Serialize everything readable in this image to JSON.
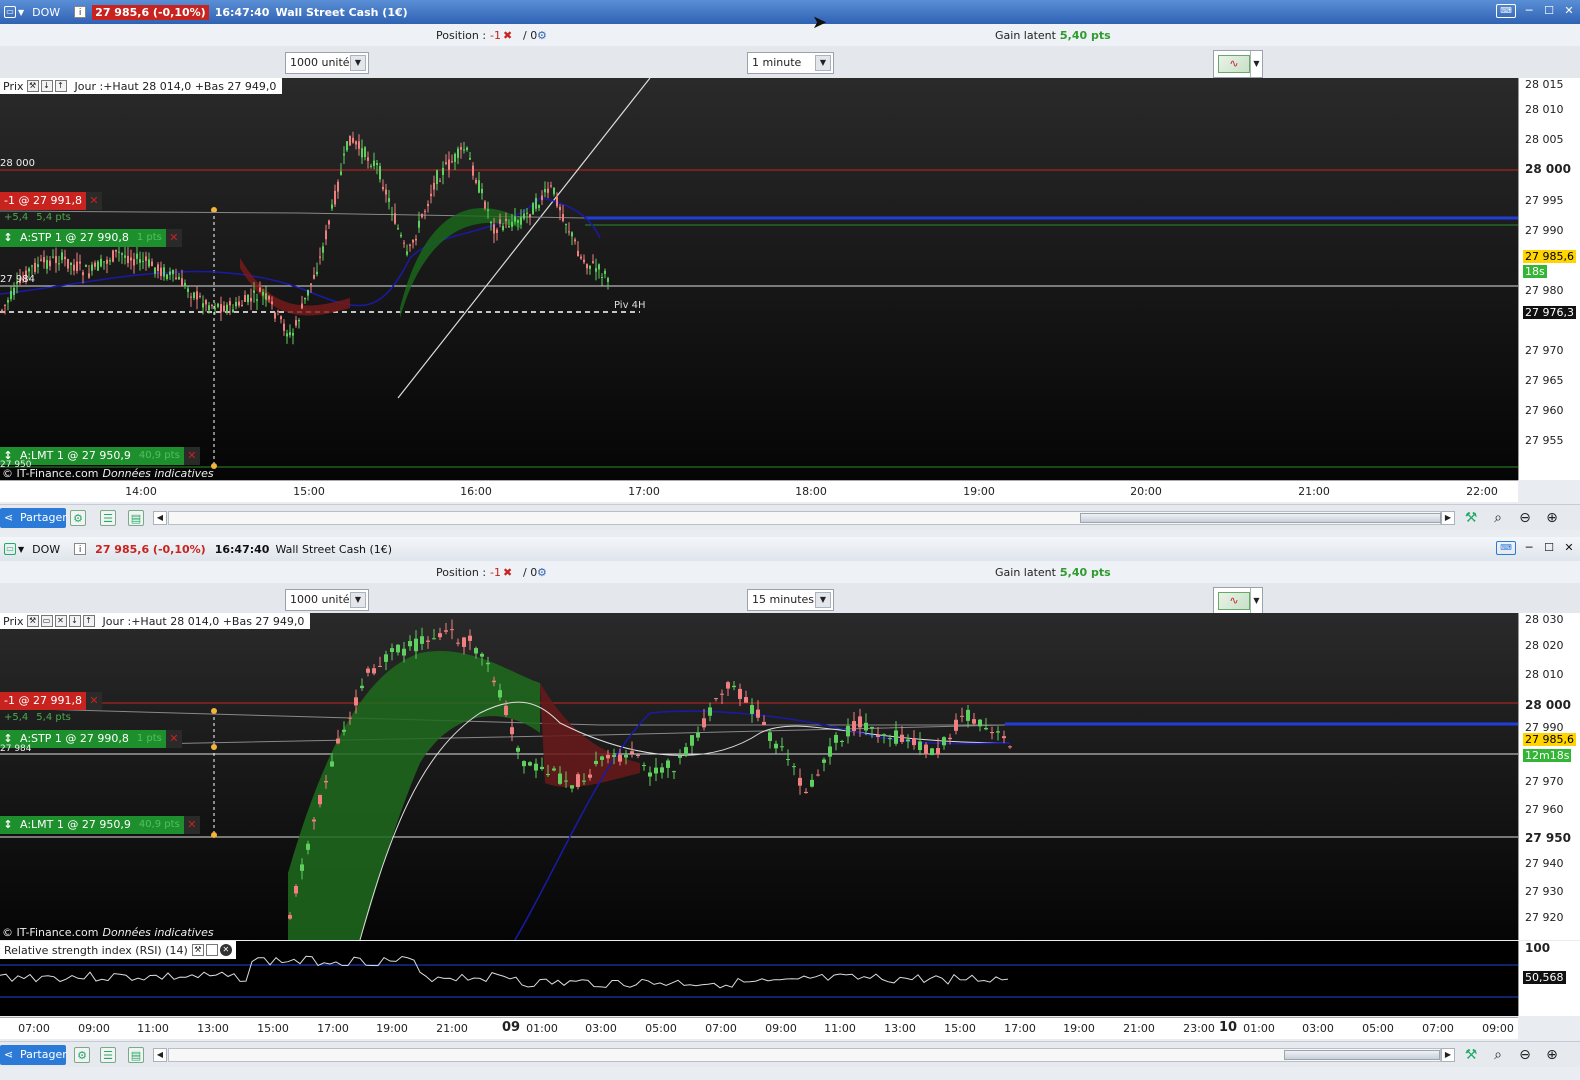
{
  "panels": [
    {
      "title": {
        "symbol": "DOW",
        "price": "27 985,6 (-0,10%)",
        "time": "16:47:40",
        "name": "Wall Street Cash (1€)"
      },
      "position": {
        "label": "Position :",
        "value": "-1",
        "close": "✖",
        "zero": "/ 0",
        "gear": "⚙"
      },
      "gain": {
        "label": "Gain latent :",
        "value": "5,40 pts"
      },
      "units_select": "1000 unités",
      "interval_select": "1 minute",
      "chart_header": {
        "prix": "Prix",
        "text": "Jour :+Haut 28 014,0 +Bas 27 949,0"
      },
      "price_axis": [
        {
          "label": "28 015",
          "style": ""
        },
        {
          "label": "28 010",
          "style": ""
        },
        {
          "label": "28 005",
          "style": ""
        },
        {
          "label": "28 000",
          "style": "bold"
        },
        {
          "label": "27 995",
          "style": ""
        },
        {
          "label": "27 990",
          "style": ""
        },
        {
          "label": "27 985,6",
          "style": "boxy"
        },
        {
          "label": "18s",
          "style": "boxg"
        },
        {
          "label": "27 980",
          "style": ""
        },
        {
          "label": "27 976,3",
          "style": "box"
        },
        {
          "label": "27 970",
          "style": ""
        },
        {
          "label": "27 965",
          "style": ""
        },
        {
          "label": "27 960",
          "style": ""
        },
        {
          "label": "27 955",
          "style": ""
        }
      ],
      "level_label": "28 000",
      "side_label": "27 984",
      "bottom_side_label": "27 950",
      "pivot_label": "Piv 4H",
      "orders": {
        "position_tag": "-1 @ 27 991,8",
        "position_sub": [
          "+5,4",
          "5,4 pts"
        ],
        "stop_tag": "A:STP  1 @ 27 990,8",
        "stop_pts": "1 pts",
        "limit_tag": "A:LMT  1 @ 27 950,9",
        "limit_pts": "40,9 pts"
      },
      "watermark": {
        "brand": "© IT-Finance.com",
        "note": "Données indicatives"
      },
      "time_axis": [
        {
          "label": "14:00"
        },
        {
          "label": "15:00"
        },
        {
          "label": "16:00"
        },
        {
          "label": "17:00"
        },
        {
          "label": "18:00"
        },
        {
          "label": "19:00"
        },
        {
          "label": "20:00"
        },
        {
          "label": "21:00"
        },
        {
          "label": "22:00"
        }
      ],
      "share_label": "Partager"
    },
    {
      "title": {
        "symbol": "DOW",
        "price": "27 985,6 (-0,10%)",
        "time": "16:47:40",
        "name": "Wall Street Cash (1€)"
      },
      "position": {
        "label": "Position :",
        "value": "-1",
        "close": "✖",
        "zero": "/ 0",
        "gear": "⚙"
      },
      "gain": {
        "label": "Gain latent :",
        "value": "5,40 pts"
      },
      "units_select": "1000 unités",
      "interval_select": "15 minutes",
      "chart_header": {
        "prix": "Prix",
        "text": "Jour :+Haut 28 014,0 +Bas 27 949,0"
      },
      "price_axis": [
        {
          "label": "28 030",
          "style": ""
        },
        {
          "label": "28 020",
          "style": ""
        },
        {
          "label": "28 010",
          "style": ""
        },
        {
          "label": "28 000",
          "style": "bold"
        },
        {
          "label": "27 990",
          "style": ""
        },
        {
          "label": "27 985,6",
          "style": "boxy"
        },
        {
          "label": "12m18s",
          "style": "boxg"
        },
        {
          "label": "27 970",
          "style": ""
        },
        {
          "label": "27 960",
          "style": ""
        },
        {
          "label": "27 950",
          "style": "bold"
        },
        {
          "label": "27 940",
          "style": ""
        },
        {
          "label": "27 930",
          "style": ""
        },
        {
          "label": "27 920",
          "style": ""
        }
      ],
      "side_label": "27 984",
      "orders": {
        "position_tag": "-1 @ 27 991,8",
        "position_sub": [
          "+5,4",
          "5,4 pts"
        ],
        "stop_tag": "A:STP  1 @ 27 990,8",
        "stop_pts": "1 pts",
        "limit_tag": "A:LMT  1 @ 27 950,9",
        "limit_pts": "40,9 pts"
      },
      "watermark": {
        "brand": "© IT-Finance.com",
        "note": "Données indicatives"
      },
      "rsi": {
        "label": "Relative strength index (RSI) (14)",
        "top": "100",
        "value": "50,568"
      },
      "time_axis": [
        {
          "label": "07:00",
          "bold": false
        },
        {
          "label": "09:00",
          "bold": false
        },
        {
          "label": "11:00",
          "bold": false
        },
        {
          "label": "13:00",
          "bold": false
        },
        {
          "label": "15:00",
          "bold": false
        },
        {
          "label": "17:00",
          "bold": false
        },
        {
          "label": "19:00",
          "bold": false
        },
        {
          "label": "21:00",
          "bold": false
        },
        {
          "label": "09",
          "bold": true
        },
        {
          "label": "01:00",
          "bold": false
        },
        {
          "label": "03:00",
          "bold": false
        },
        {
          "label": "05:00",
          "bold": false
        },
        {
          "label": "07:00",
          "bold": false
        },
        {
          "label": "09:00",
          "bold": false
        },
        {
          "label": "11:00",
          "bold": false
        },
        {
          "label": "13:00",
          "bold": false
        },
        {
          "label": "15:00",
          "bold": false
        },
        {
          "label": "17:00",
          "bold": false
        },
        {
          "label": "19:00",
          "bold": false
        },
        {
          "label": "21:00",
          "bold": false
        },
        {
          "label": "23:00",
          "bold": false
        },
        {
          "label": "10",
          "bold": true
        },
        {
          "label": "01:00",
          "bold": false
        },
        {
          "label": "03:00",
          "bold": false
        },
        {
          "label": "05:00",
          "bold": false
        },
        {
          "label": "07:00",
          "bold": false
        },
        {
          "label": "09:00",
          "bold": false
        }
      ],
      "share_label": "Partager"
    }
  ],
  "colors": {
    "bull": "#5fd05f",
    "bear": "#f08080",
    "ma": "#1a1aa8",
    "level_red": "#c8231e",
    "level_blue": "#1f3fd8",
    "accent": "#2b7ad8"
  }
}
